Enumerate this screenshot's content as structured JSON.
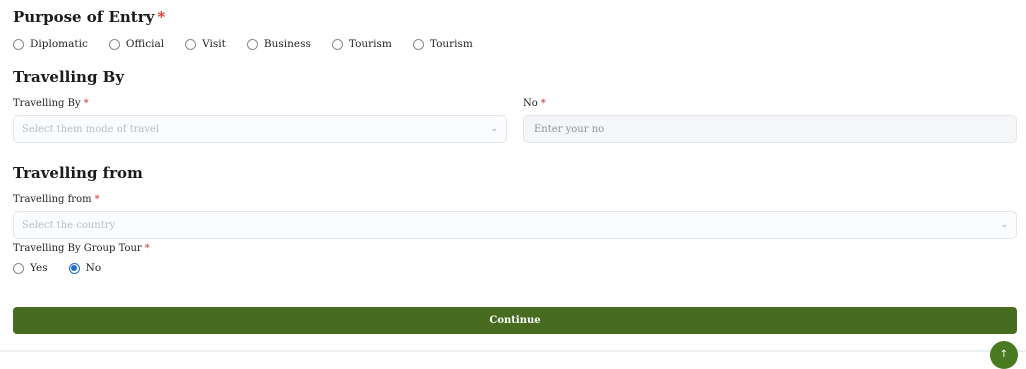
{
  "purpose": {
    "title": "Purpose of Entry",
    "required_mark": "*",
    "options": [
      "Diplomatic",
      "Official",
      "Visit",
      "Business",
      "Tourism",
      "Tourism"
    ]
  },
  "travelling_by": {
    "title": "Travelling By",
    "mode_label": "Travelling By",
    "mode_placeholder": "Select them mode of travel",
    "no_label": "No",
    "no_placeholder": "Enter your no",
    "required_mark": "*"
  },
  "travelling_from": {
    "title": "Travelling from",
    "country_label": "Travelling from",
    "country_placeholder": "Select the country",
    "group_tour_label": "Travelling By Group Tour",
    "group_tour_options": [
      "Yes",
      "No"
    ],
    "group_tour_selected": "No",
    "required_mark": "*"
  },
  "actions": {
    "continue_label": "Continue",
    "scroll_top_icon": "arrow-up-icon",
    "brand_color": "#476c1f",
    "radio_selected_color": "#1f6bd6"
  }
}
